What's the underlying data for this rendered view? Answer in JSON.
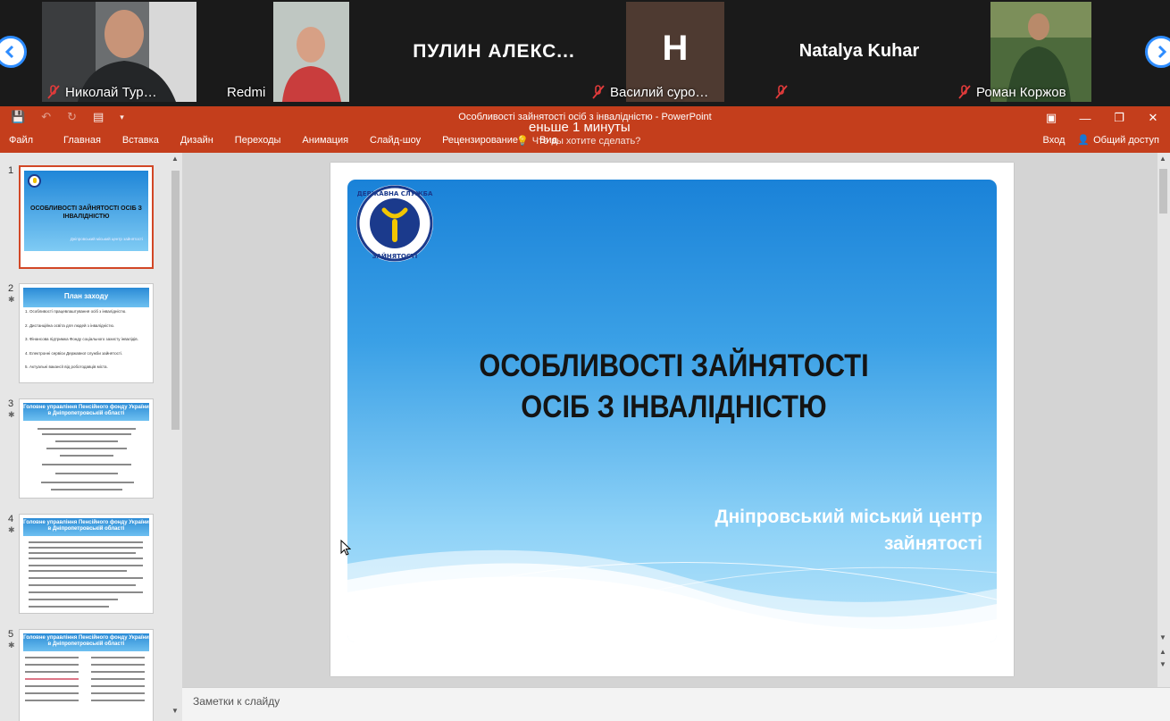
{
  "video": {
    "participants": [
      {
        "name": "Николай Тур…",
        "muted": true
      },
      {
        "name": "Redmi",
        "muted": false
      },
      {
        "name": "ПУЛИН  АЛЕКС...",
        "muted": false
      },
      {
        "name": "Василий суро…",
        "initial": "H",
        "muted": true
      },
      {
        "name": "Natalya Kuhar",
        "muted": true
      },
      {
        "name": "Роман Коржов",
        "muted": true
      }
    ]
  },
  "overlay": "еньше 1 минуты",
  "window": {
    "title": "Особливості зайнятості осіб з інвалідністю - PowerPoint"
  },
  "ribbon": {
    "tabs": [
      "Файл",
      "Главная",
      "Вставка",
      "Дизайн",
      "Переходы",
      "Анимация",
      "Слайд-шоу",
      "Рецензирование",
      "Вид"
    ],
    "search_placeholder": "Что вы хотите сделать?",
    "signin": "Вход",
    "share": "Общий доступ"
  },
  "thumbnails": [
    {
      "num": "1",
      "title": "ОСОБЛИВОСТІ ЗАЙНЯТОСТІ ОСІБ З ІНВАЛІДНІСТЮ",
      "subtitle": "Дніпровський міський центр зайнятості",
      "selected": true
    },
    {
      "num": "2",
      "title": "План заходу",
      "items": [
        "1. Особливості працевлаштування осіб з інвалідністю.",
        "2. Дистанційна освіта для людей з інвалідністю.",
        "3. Фінансова підтримка Фонду соціального захисту інвалідів.",
        "4. Електронні сервіси Державної служби зайнятості.",
        "5. Актуальні вакансії від роботодавців міста."
      ]
    },
    {
      "num": "3",
      "title": "Головне управління Пенсійного фонду України в Дніпропетровській області"
    },
    {
      "num": "4",
      "title": "Головне управління Пенсійного фонду України в Дніпропетровській області"
    },
    {
      "num": "5",
      "title": "Головне управління Пенсійного фонду України в Дніпропетровській області"
    }
  ],
  "slide": {
    "title_line1": "ОСОБЛИВОСТІ ЗАЙНЯТОСТІ",
    "title_line2": "ОСІБ З ІНВАЛІДНІСТЮ",
    "subtitle_line1": "Дніпровський міський центр",
    "subtitle_line2": "зайнятості",
    "logo_text_top": "ДЕРЖАВНА СЛУЖБА",
    "logo_text_bottom": "ЗАЙНЯТОСТІ"
  },
  "notes_placeholder": "Заметки к слайду"
}
